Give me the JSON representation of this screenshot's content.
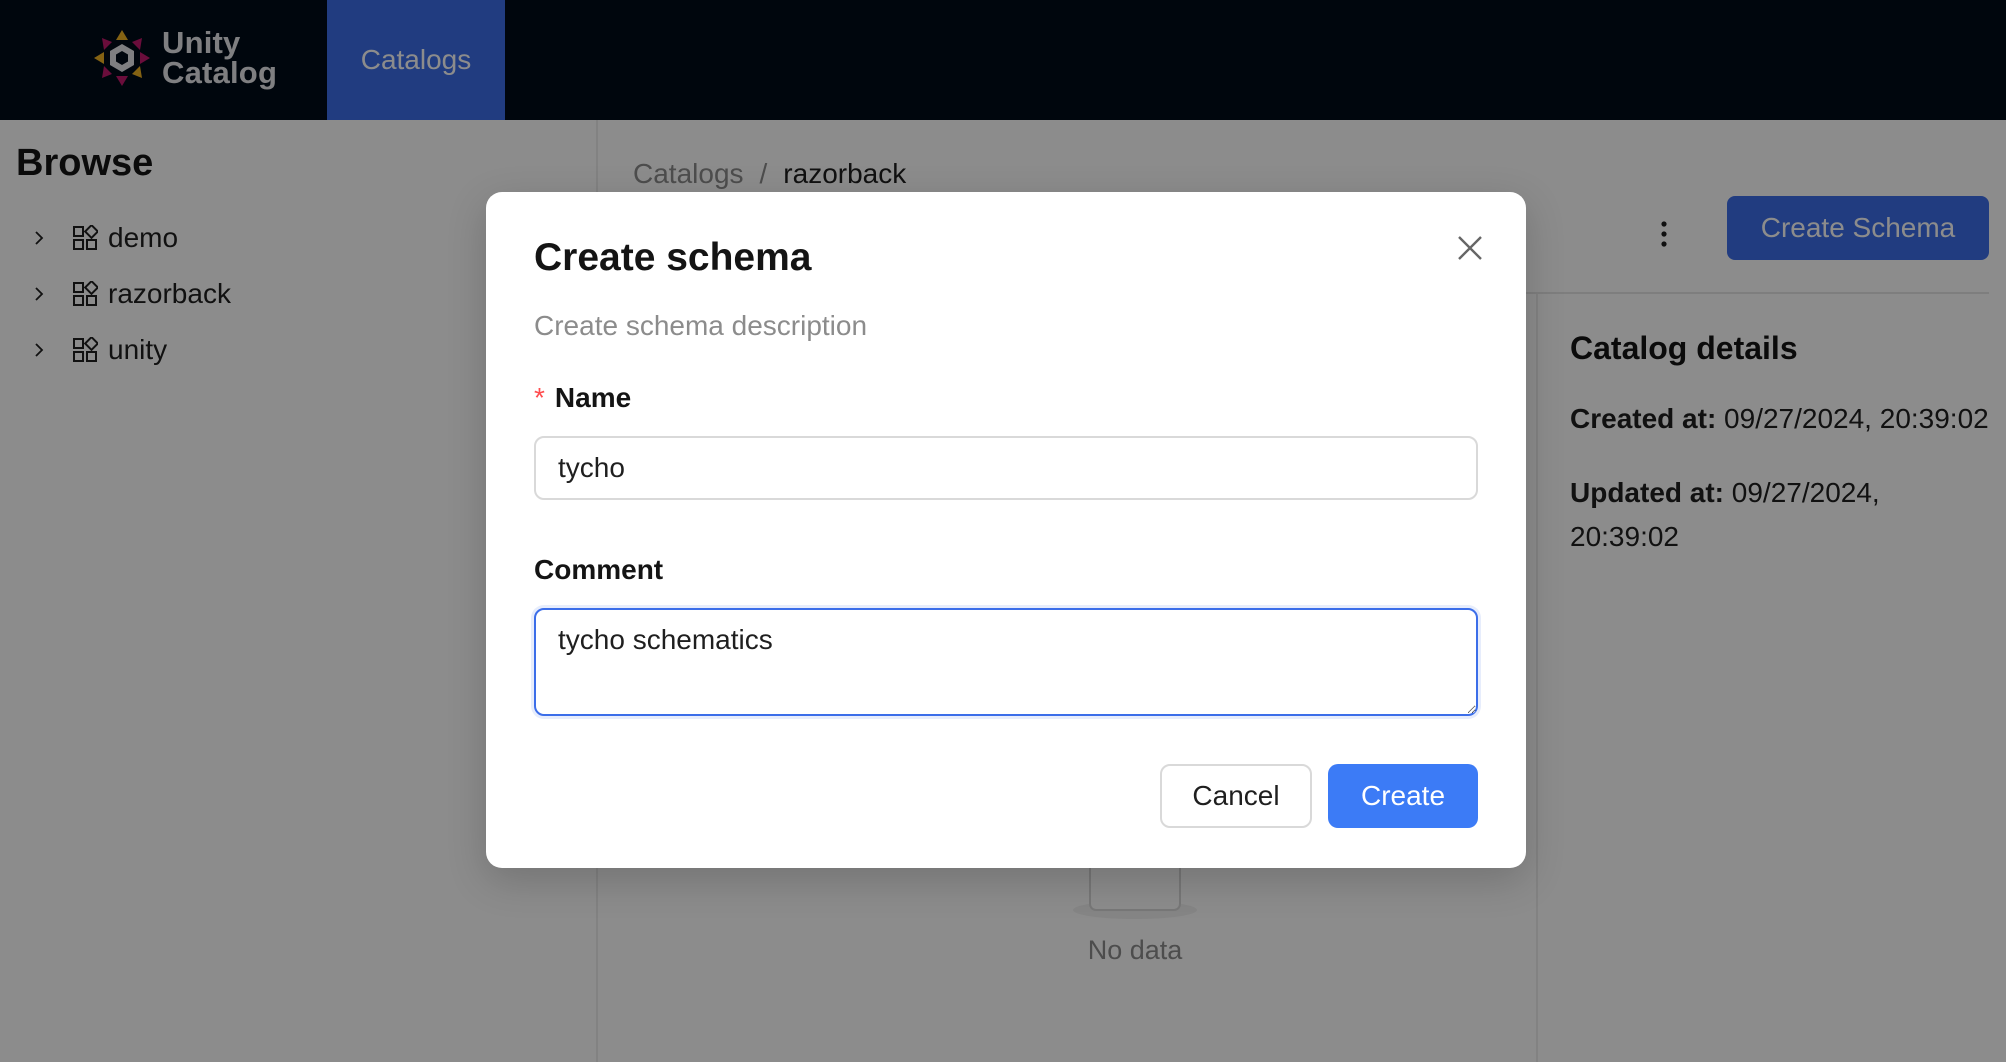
{
  "header": {
    "logo_text_line1": "Unity",
    "logo_text_line2": "Catalog",
    "nav_tab": "Catalogs"
  },
  "sidebar": {
    "title": "Browse",
    "items": [
      {
        "label": "demo"
      },
      {
        "label": "razorback"
      },
      {
        "label": "unity"
      }
    ]
  },
  "main": {
    "breadcrumb": {
      "root": "Catalogs",
      "separator": "/",
      "current": "razorback"
    },
    "create_schema_button": "Create Schema",
    "empty_text": "No data",
    "details": {
      "title": "Catalog details",
      "created_label": "Created at:",
      "created_value": "09/27/2024, 20:39:02",
      "updated_label": "Updated at:",
      "updated_value": "09/27/2024, 20:39:02"
    }
  },
  "modal": {
    "title": "Create schema",
    "description": "Create schema description",
    "name_label": "Name",
    "required_mark": "*",
    "name_value": "tycho",
    "comment_label": "Comment",
    "comment_value": "tycho schematics",
    "cancel_label": "Cancel",
    "create_label": "Create"
  },
  "colors": {
    "header_bg": "#000b18",
    "accent": "#3c6ee9",
    "create_button": "#3c7bf6",
    "required": "#ff4d4f"
  },
  "icons": [
    "unity-catalog-logo-icon",
    "chevron-right-icon",
    "catalog-grid-icon",
    "more-vertical-icon",
    "close-icon",
    "empty-box-icon"
  ]
}
